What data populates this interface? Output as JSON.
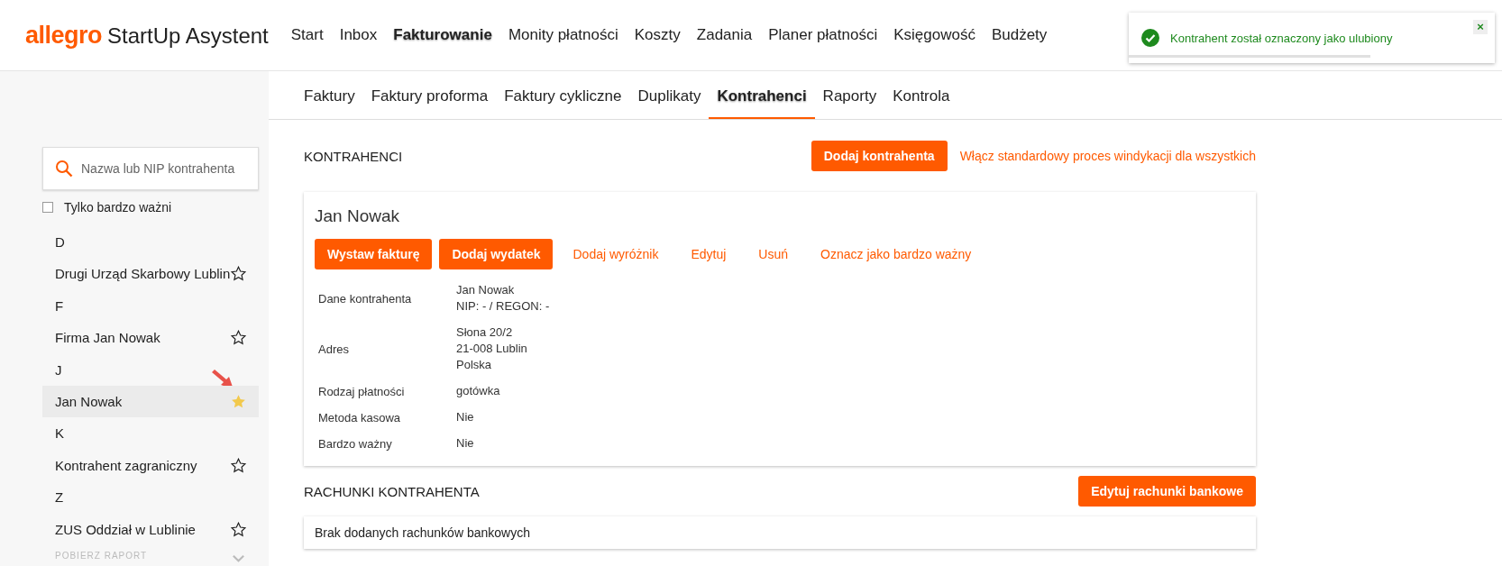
{
  "header": {
    "logo": {
      "brand": "allegro",
      "product": "StartUp Asystent"
    },
    "nav": [
      {
        "label": "Start",
        "selected": false
      },
      {
        "label": "Inbox",
        "selected": false
      },
      {
        "label": "Fakturowanie",
        "selected": true
      },
      {
        "label": "Monity płatności",
        "selected": false
      },
      {
        "label": "Koszty",
        "selected": false
      },
      {
        "label": "Zadania",
        "selected": false
      },
      {
        "label": "Planer płatności",
        "selected": false
      },
      {
        "label": "Księgowość",
        "selected": false
      },
      {
        "label": "Budżety",
        "selected": false
      }
    ]
  },
  "toast": {
    "message": "Kontrahent został oznaczony jako ulubiony",
    "close": "×",
    "level": 0.66
  },
  "subnav": [
    {
      "label": "Faktury",
      "selected": false
    },
    {
      "label": "Faktury proforma",
      "selected": false
    },
    {
      "label": "Faktury cykliczne",
      "selected": false
    },
    {
      "label": "Duplikaty",
      "selected": false
    },
    {
      "label": "Kontrahenci",
      "selected": true
    },
    {
      "label": "Raporty",
      "selected": false
    },
    {
      "label": "Kontrola",
      "selected": false
    }
  ],
  "sidebar": {
    "search": {
      "placeholder": "Nazwa lub NIP kontrahenta"
    },
    "filter": {
      "label": "Tylko bardzo ważni",
      "checked": false
    },
    "groups": [
      {
        "letter": "D",
        "contacts": [
          {
            "name": "Drugi Urząd Skarbowy Lublin",
            "favorite": false,
            "selected": false
          }
        ]
      },
      {
        "letter": "F",
        "contacts": [
          {
            "name": "Firma Jan Nowak",
            "favorite": false,
            "selected": false
          }
        ]
      },
      {
        "letter": "J",
        "contacts": [
          {
            "name": "Jan Nowak",
            "favorite": true,
            "selected": true
          }
        ]
      },
      {
        "letter": "K",
        "contacts": [
          {
            "name": "Kontrahent zagraniczny",
            "favorite": false,
            "selected": false
          }
        ]
      },
      {
        "letter": "Z",
        "contacts": [
          {
            "name": "ZUS Oddział w Lublinie",
            "favorite": false,
            "selected": false
          }
        ]
      }
    ],
    "footer_link": "POBIERZ RAPORT"
  },
  "main": {
    "title": "KONTRAHENCI",
    "add_button": "Dodaj kontrahenta",
    "link": "Włącz standardowy proces windykacji dla wszystkich",
    "contractor": {
      "name": "Jan Nowak",
      "actions": [
        {
          "label": "Wystaw fakturę",
          "kind": "primary"
        },
        {
          "label": "Dodaj wydatek",
          "kind": "primary"
        },
        {
          "label": "Dodaj wyróżnik",
          "kind": "link"
        },
        {
          "label": "Edytuj",
          "kind": "link"
        },
        {
          "label": "Usuń",
          "kind": "link"
        },
        {
          "label": "Oznacz jako bardzo ważny",
          "kind": "link"
        }
      ],
      "details": [
        {
          "label": "Dane kontrahenta",
          "lines": [
            "Jan Nowak",
            "NIP: - / REGON: -"
          ]
        },
        {
          "label": "Adres",
          "lines": [
            "Słona 20/2",
            "21-008 Lublin",
            "Polska"
          ]
        },
        {
          "label": "Rodzaj płatności",
          "lines": [
            "gotówka"
          ]
        },
        {
          "label": "Metoda kasowa",
          "lines": [
            "Nie"
          ]
        },
        {
          "label": "Bardzo ważny",
          "lines": [
            "Nie"
          ]
        }
      ]
    },
    "accounts": {
      "title": "RACHUNKI KONTRAHENTA",
      "button": "Edytuj rachunki bankowe",
      "empty": "Brak dodanych rachunków bankowych"
    }
  }
}
